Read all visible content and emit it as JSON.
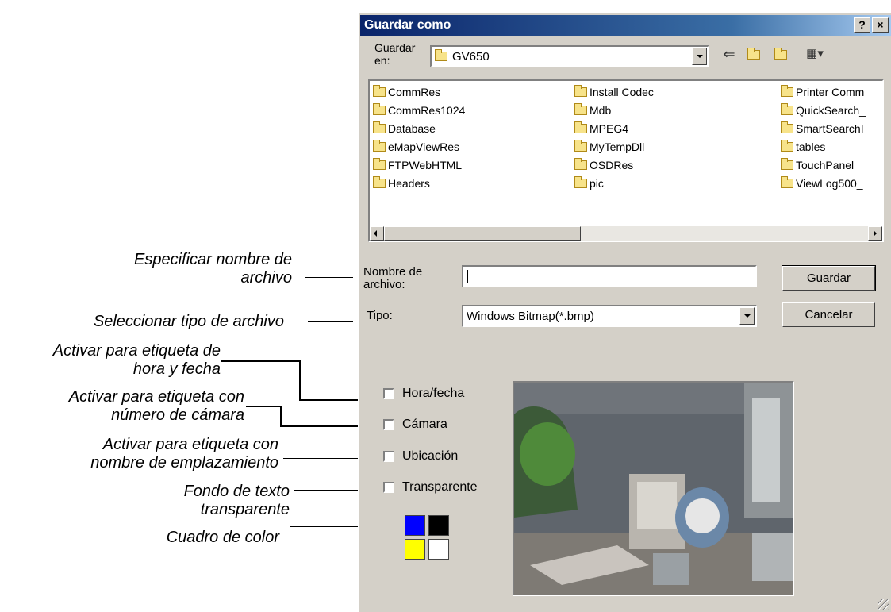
{
  "annotations": {
    "filename": [
      "Especificar nombre de",
      "archivo"
    ],
    "filetype": "Seleccionar tipo de archivo",
    "datetime": [
      "Activar para etiqueta de",
      "hora y fecha"
    ],
    "camera": [
      "Activar para etiqueta con",
      "número de cámara"
    ],
    "location": [
      "Activar para etiqueta con",
      "nombre de emplazamiento"
    ],
    "transparent": [
      "Fondo de texto",
      "transparente"
    ],
    "color": "Cuadro de color"
  },
  "dialog": {
    "title": "Guardar como",
    "help_button": "?",
    "close_button": "×",
    "save_in_label": [
      "Guardar",
      "en:"
    ],
    "save_in_value": "GV650",
    "toolbar_icons": [
      "back-arrow-icon",
      "up-folder-icon",
      "new-folder-icon",
      "view-menu-icon"
    ],
    "files": [
      [
        "CommRes",
        "CommRes1024",
        "Database",
        "eMapViewRes",
        "FTPWebHTML",
        "Headers"
      ],
      [
        "Install Codec",
        "Mdb",
        "MPEG4",
        "MyTempDll",
        "OSDRes",
        "pic"
      ],
      [
        "Printer Comm",
        "QuickSearch_",
        "SmartSearchI",
        "tables",
        "TouchPanel",
        "ViewLog500_"
      ]
    ],
    "filename_label": [
      "Nombre de",
      "archivo:"
    ],
    "filename_value": "",
    "type_label": "Tipo:",
    "type_value": "Windows Bitmap(*.bmp)",
    "save_button": "Guardar",
    "cancel_button": "Cancelar",
    "checkboxes": [
      "Hora/fecha",
      "Cámara",
      "Ubicación",
      "Transparente"
    ],
    "colors": [
      "#0000ff",
      "#000000",
      "#ffff00",
      "#ffffff"
    ]
  }
}
